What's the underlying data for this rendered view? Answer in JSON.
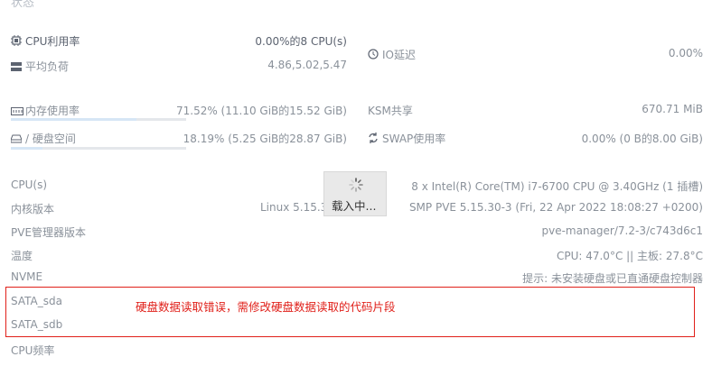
{
  "header": {
    "title": "状态"
  },
  "stats": {
    "cpu_usage": {
      "label": "CPU利用率",
      "value": "0.00%的8 CPU(s)"
    },
    "load_avg": {
      "label": "平均负荷",
      "value": "4.86,5.02,5.47"
    },
    "io_delay": {
      "label": "IO延迟",
      "value": "0.00%"
    },
    "memory": {
      "label": "内存使用率",
      "value": "71.52% (11.10 GiB的15.52 GiB)",
      "percent": 71.52
    },
    "ksm": {
      "label": "KSM共享",
      "value": "670.71 MiB"
    },
    "disk": {
      "label": "/ 硬盘空间",
      "value": "18.19% (5.25 GiB的28.87 GiB)",
      "percent": 18.19
    },
    "swap": {
      "label": "SWAP使用率",
      "value": "0.00% (0 B的8.00 GiB)"
    }
  },
  "info": {
    "cpu_label": "CPU(s)",
    "cpu_value": "8 x Intel(R) Core(TM) i7-6700 CPU @ 3.40GHz (1 插槽)",
    "kernel_label": "内核版本",
    "kernel_value_left": "Linux 5.15.3",
    "kernel_value_right": "SMP PVE 5.15.30-3 (Fri, 22 Apr 2022 18:08:27 +0200)",
    "pve_label": "PVE管理器版本",
    "pve_value": "pve-manager/7.2-3/c743d6c1",
    "temp_label": "温度",
    "temp_value": "CPU: 47.0°C || 主板: 27.8°C",
    "nvme_label": "NVME",
    "nvme_value": "提示: 未安装硬盘或已直通硬盘控制器",
    "sata_sda_label": "SATA_sda",
    "sata_sdb_label": "SATA_sdb",
    "cpu_freq_label": "CPU频率"
  },
  "loading": {
    "text": "载入中..."
  },
  "annotation": {
    "text": "硬盘数据读取错误，需修改硬盘数据读取的代码片段"
  }
}
